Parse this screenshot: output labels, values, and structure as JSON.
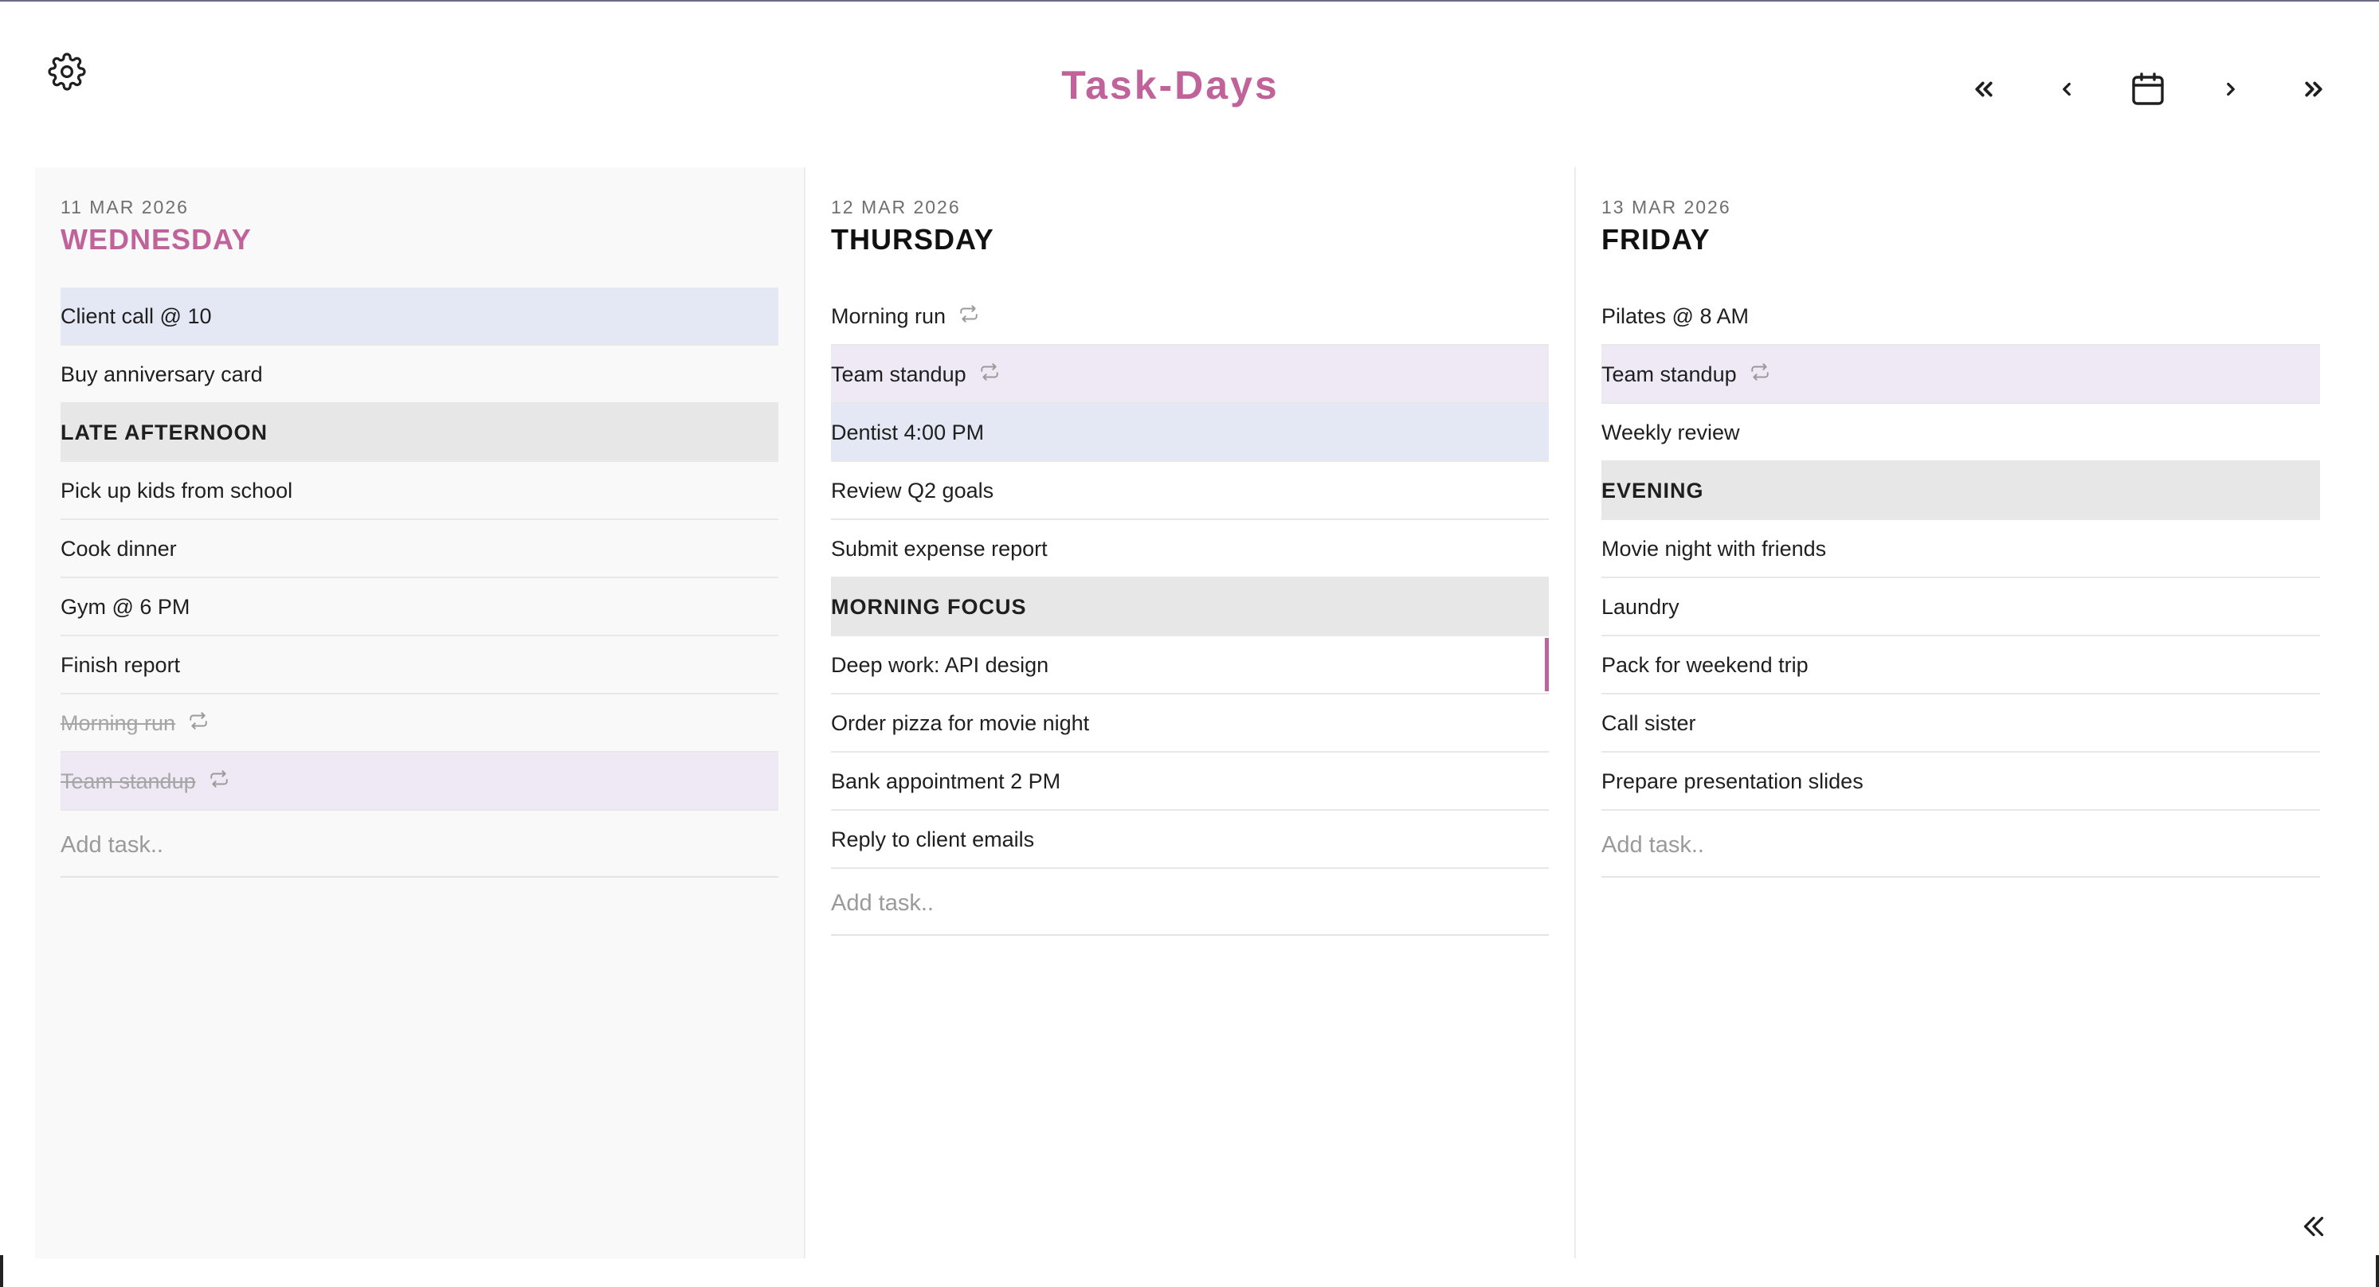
{
  "app": {
    "title": "Task-Days"
  },
  "colors": {
    "accent": "#c0639a",
    "blue_tag": "#e4e8f4",
    "purple_tag": "#efe9f6",
    "section_bg": "#e7e7e7"
  },
  "icons": {
    "settings": "gear-icon",
    "first": "double-chevron-left-icon",
    "prev": "chevron-left-icon",
    "today": "calendar-icon",
    "next": "chevron-right-icon",
    "last": "double-chevron-right-icon",
    "repeat": "repeat-icon",
    "collapse": "double-chevron-left-icon"
  },
  "add_task_placeholder": "Add task..",
  "days": [
    {
      "date": "11 MAR 2026",
      "name": "WEDNESDAY",
      "today": true,
      "tasks": [
        {
          "text": "Client call @ 10",
          "color": "blue"
        },
        {
          "text": "Buy anniversary card"
        },
        {
          "text": "LATE AFTERNOON",
          "section": true
        },
        {
          "text": "Pick up kids from school"
        },
        {
          "text": "Cook dinner"
        },
        {
          "text": "Gym @ 6 PM"
        },
        {
          "text": "Finish report"
        },
        {
          "text": "Morning run",
          "done": true,
          "repeat": true
        },
        {
          "text": "Team standup",
          "done": true,
          "repeat": true,
          "color": "purple"
        }
      ]
    },
    {
      "date": "12 MAR 2026",
      "name": "THURSDAY",
      "tasks": [
        {
          "text": "Morning run",
          "repeat": true
        },
        {
          "text": "Team standup",
          "repeat": true,
          "color": "purple"
        },
        {
          "text": "Dentist 4:00 PM",
          "color": "blue"
        },
        {
          "text": "Review Q2 goals"
        },
        {
          "text": "Submit expense report"
        },
        {
          "text": "MORNING FOCUS",
          "section": true
        },
        {
          "text": "Deep work: API design",
          "accent": true
        },
        {
          "text": "Order pizza for movie night"
        },
        {
          "text": "Bank appointment 2 PM"
        },
        {
          "text": "Reply to client emails"
        }
      ]
    },
    {
      "date": "13 MAR 2026",
      "name": "FRIDAY",
      "tasks": [
        {
          "text": "Pilates @ 8 AM"
        },
        {
          "text": "Team standup",
          "repeat": true,
          "color": "purple"
        },
        {
          "text": "Weekly review"
        },
        {
          "text": "EVENING",
          "section": true
        },
        {
          "text": "Movie night with friends"
        },
        {
          "text": "Laundry"
        },
        {
          "text": "Pack for weekend trip"
        },
        {
          "text": "Call sister"
        },
        {
          "text": "Prepare presentation slides"
        }
      ]
    }
  ]
}
